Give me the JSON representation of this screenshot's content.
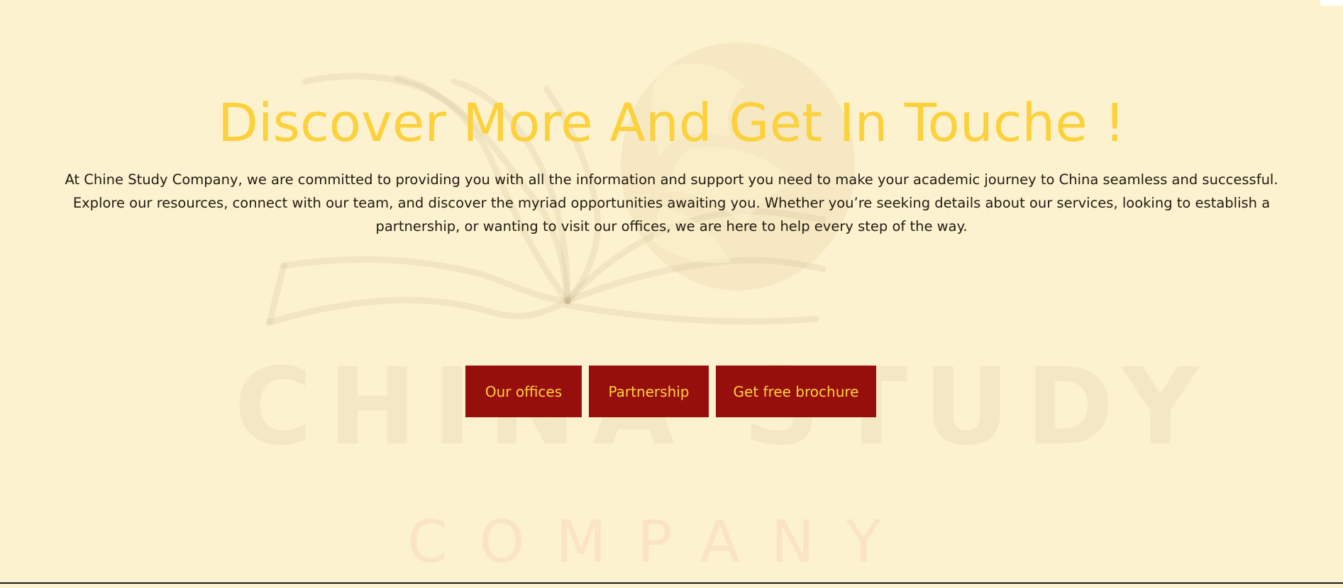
{
  "hero": {
    "title": "Discover More And Get In Touche !",
    "text": "At Chine Study Company, we are committed to providing you with all the information and support you need to make your academic journey to China seamless and successful. Explore our resources, connect with our team, and discover the myriad opportunities awaiting you. Whether you’re seeking details about our services, looking to establish a partnership, or wanting to visit our offices, we are here to help every step of the way."
  },
  "actions": {
    "offices_label": "Our offices",
    "partnership_label": "Partnership",
    "brochure_label": "Get free brochure"
  },
  "watermark": {
    "brand": "CHINA STUDY",
    "sub": "COMPANY"
  },
  "colors": {
    "background": "#fdf2cf",
    "title": "#fcd13c",
    "button_bg": "#970f0c",
    "button_text": "#fcd13c",
    "body_text": "#1f1a10"
  }
}
